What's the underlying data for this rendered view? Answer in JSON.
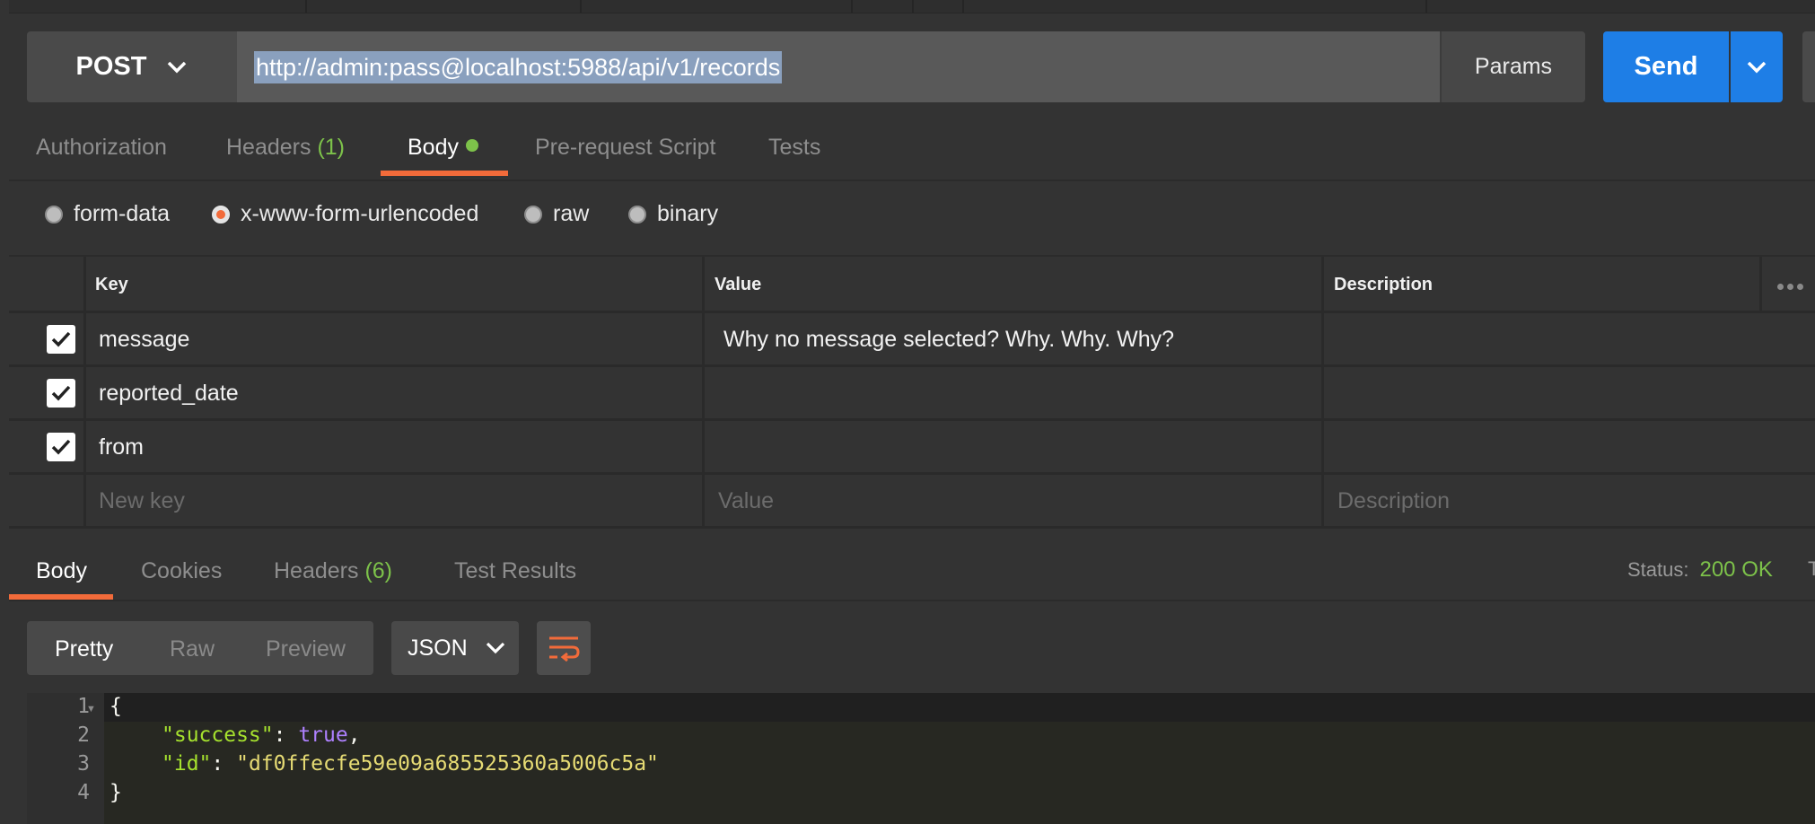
{
  "request": {
    "method": "POST",
    "url": "http://admin:pass@localhost:5988/api/v1/records",
    "params_label": "Params",
    "send_label": "Send"
  },
  "request_tabs": {
    "authorization": "Authorization",
    "headers": "Headers",
    "headers_count": "(1)",
    "body": "Body",
    "prerequest": "Pre-request Script",
    "tests": "Tests"
  },
  "body_types": {
    "form_data": "form-data",
    "urlencoded": "x-www-form-urlencoded",
    "raw": "raw",
    "binary": "binary",
    "selected": "x-www-form-urlencoded"
  },
  "table": {
    "headers": {
      "key": "Key",
      "value": "Value",
      "description": "Description"
    },
    "rows": [
      {
        "checked": true,
        "key": "message",
        "value": "Why no message selected? Why. Why. Why?",
        "description": ""
      },
      {
        "checked": true,
        "key": "reported_date",
        "value": "",
        "description": ""
      },
      {
        "checked": true,
        "key": "from",
        "value": "",
        "description": ""
      }
    ],
    "placeholders": {
      "key": "New key",
      "value": "Value",
      "description": "Description"
    }
  },
  "response": {
    "tabs": {
      "body": "Body",
      "cookies": "Cookies",
      "headers": "Headers",
      "headers_count": "(6)",
      "test_results": "Test Results"
    },
    "status_label": "Status:",
    "status_value": "200 OK",
    "status_next": "T",
    "view_modes": {
      "pretty": "Pretty",
      "raw": "Raw",
      "preview": "Preview"
    },
    "format": "JSON",
    "code": {
      "line_numbers": [
        "1",
        "2",
        "3",
        "4"
      ],
      "open_brace": "{",
      "close_brace": "}",
      "success_key": "\"success\"",
      "success_value": "true",
      "id_key": "\"id\"",
      "id_value": "\"df0ffecfe59e09a685525360a5006c5a\""
    }
  },
  "colors": {
    "accent": "#f26b3a",
    "send_blue": "#1e7ee6",
    "success_green": "#7dc24a",
    "background": "#333333"
  },
  "icons": [
    "chevron-down-icon",
    "checkbox-checked-icon",
    "more-dots-icon",
    "wrap-lines-icon"
  ]
}
